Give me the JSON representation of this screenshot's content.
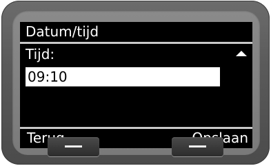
{
  "screen": {
    "title": "Datum/tijd",
    "field_label": "Tijd:",
    "field_value": "09:10",
    "scroll_indicator_icon": "up-triangle-icon"
  },
  "softkeys": {
    "left_label": "Terug",
    "right_label": "Opslaan"
  },
  "colors": {
    "screen_background": "#000000",
    "screen_text": "#ffffff",
    "input_background": "#ffffff",
    "device_body": "#5a5a5a"
  }
}
